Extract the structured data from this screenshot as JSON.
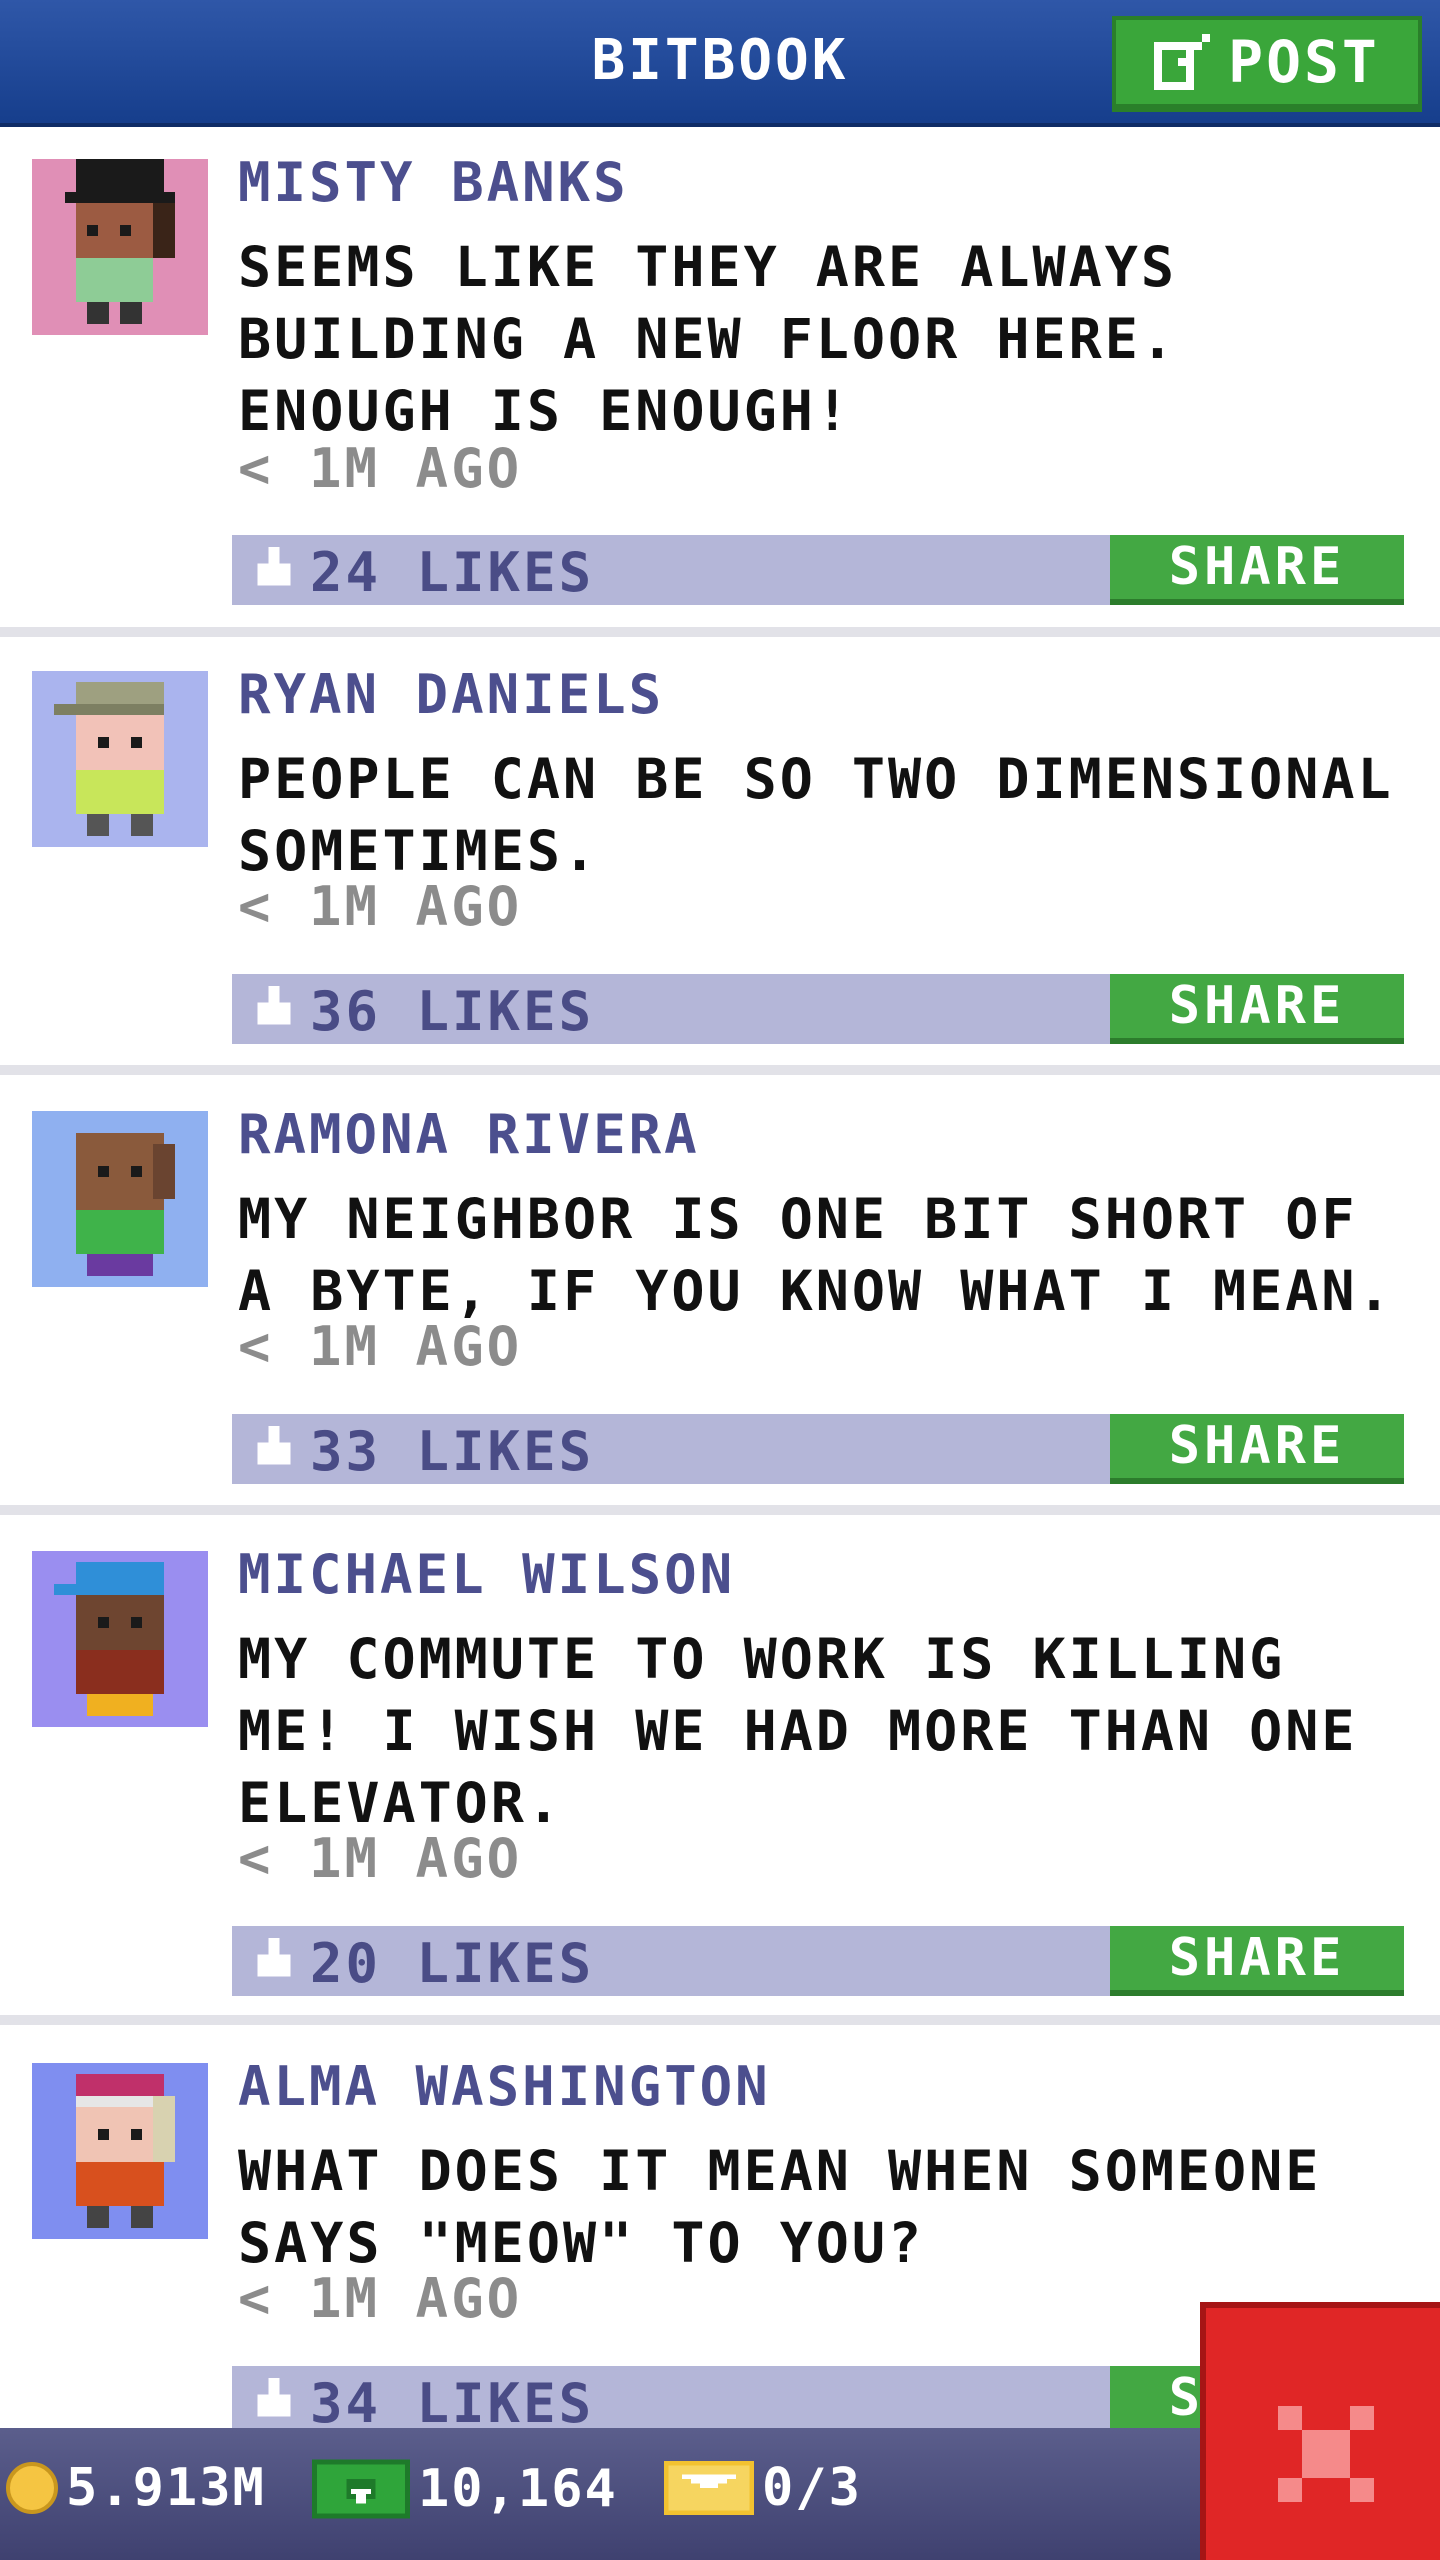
{
  "header": {
    "title": "BITBOOK",
    "post_label": "POST",
    "post_icon": "edit-icon",
    "colors": {
      "bar": "#1f4a9c",
      "post_button": "#3aa63a"
    }
  },
  "posts": [
    {
      "name": "MISTY BANKS",
      "message": "SEEMS LIKE THEY ARE ALWAYS BUILDING A NEW FLOOR HERE. ENOUGH IS ENOUGH!",
      "time": "< 1M AGO",
      "likes": "24 LIKES",
      "share_label": "SHARE",
      "avatar_bg": "#e08fb6"
    },
    {
      "name": "RYAN DANIELS",
      "message": "PEOPLE CAN BE SO TWO DIMENSIONAL SOMETIMES.",
      "time": "< 1M AGO",
      "likes": "36 LIKES",
      "share_label": "SHARE",
      "avatar_bg": "#aab4ee"
    },
    {
      "name": "RAMONA RIVERA",
      "message": "MY NEIGHBOR IS ONE BIT SHORT OF A BYTE, IF YOU KNOW WHAT I MEAN.",
      "time": "< 1M AGO",
      "likes": "33 LIKES",
      "share_label": "SHARE",
      "avatar_bg": "#8fb0f0"
    },
    {
      "name": "MICHAEL WILSON",
      "message": "MY COMMUTE TO WORK IS KILLING ME! I WISH WE HAD MORE THAN ONE ELEVATOR.",
      "time": "< 1M AGO",
      "likes": "20 LIKES",
      "share_label": "SHARE",
      "avatar_bg": "#9a8ef0"
    },
    {
      "name": "ALMA WASHINGTON",
      "message": "WHAT DOES IT MEAN WHEN SOMEONE SAYS \"MEOW\" TO YOU?",
      "time": "< 1M AGO",
      "likes": "34 LIKES",
      "share_label": "SHARE",
      "avatar_bg": "#7f8ef0"
    }
  ],
  "status": {
    "coins": "5.913M",
    "bux": "10,164",
    "tickets": "0/3",
    "icons": [
      "coin-icon",
      "bux-icon",
      "ticket-icon"
    ]
  },
  "close_icon": "close-icon"
}
